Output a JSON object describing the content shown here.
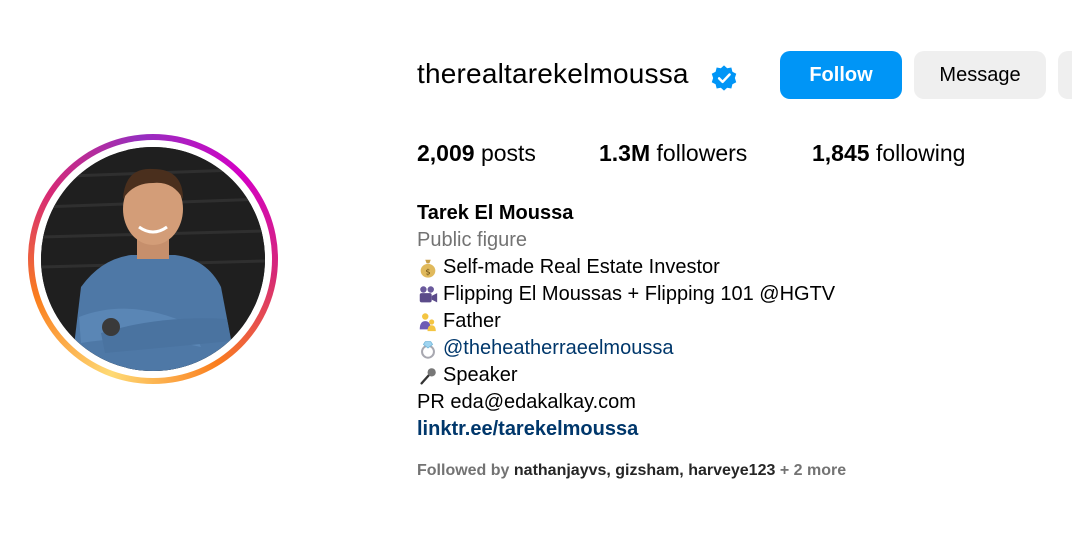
{
  "profile": {
    "username": "therealtarekelmoussa",
    "verified_icon": "verified-badge-icon",
    "accent_color": "#0095f6"
  },
  "actions": {
    "follow_label": "Follow",
    "message_label": "Message"
  },
  "stats": {
    "posts_count": "2,009",
    "posts_label": "posts",
    "followers_count": "1.3M",
    "followers_label": "followers",
    "following_count": "1,845",
    "following_label": "following"
  },
  "bio": {
    "full_name": "Tarek El Moussa",
    "category": "Public figure",
    "lines": [
      {
        "icon": "money-bag-icon",
        "text": "Self-made Real Estate Investor"
      },
      {
        "icon": "movie-camera-icon",
        "text": "Flipping El Moussas + Flipping 101 @HGTV"
      },
      {
        "icon": "family-icon",
        "text": "Father"
      },
      {
        "icon": "ring-icon",
        "text": "@theheatherraeelmoussa"
      },
      {
        "icon": "microphone-icon",
        "text": "Speaker"
      }
    ],
    "contact": "PR eda@edakalkay.com",
    "link": "linktr.ee/tarekelmoussa"
  },
  "followed_by": {
    "prefix": "Followed by",
    "users": [
      "nathanjayvs",
      "gizsham",
      "harveye123"
    ],
    "separator": ", ",
    "more": "+ 2 more"
  }
}
